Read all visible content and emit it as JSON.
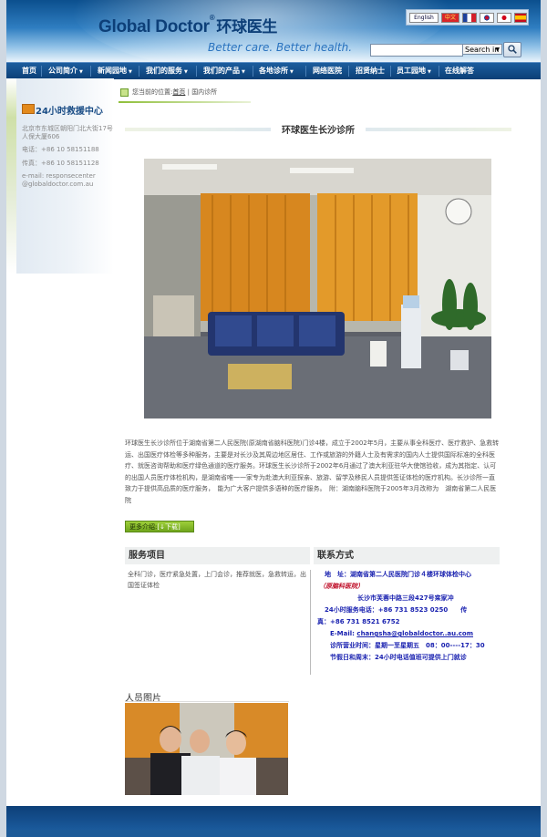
{
  "header": {
    "logo_en": "Global Doctor",
    "logo_reg": "®",
    "logo_cn": "环球医生",
    "slogan": "Better care. Better health.",
    "languages": [
      "English",
      "中文"
    ],
    "search": {
      "placeholder": "",
      "scope_option": "Search in"
    }
  },
  "nav": {
    "items": [
      {
        "label": "首页"
      },
      {
        "label": "公司简介"
      },
      {
        "label": "新闻园地"
      },
      {
        "label": "我们的服务"
      },
      {
        "label": "我们的产品"
      },
      {
        "label": "各地诊所"
      },
      {
        "label": "网络医院"
      },
      {
        "label": "招贤纳士"
      },
      {
        "label": "员工园地"
      },
      {
        "label": "在线解答"
      }
    ]
  },
  "sidebar": {
    "title": "24小时救援中心",
    "address": "北京市东城区朝阳门北大街17号人保大厦606",
    "phone": "电话：+86 10 58151188",
    "fax": "传真：+86 10 58151128",
    "email": "e-mail: responsecenter @globaldoctor.com.au"
  },
  "breadcrumb": {
    "prefix": "您当前的位置:",
    "home": "首页",
    "sep": "|",
    "current": "国内诊所"
  },
  "page": {
    "title": "环球医生长沙诊所",
    "description": "环球医生长沙诊所位于湖南省第二人民医院(原湖南省脑科医院)门诊4楼，成立于2002年5月，主要从事全科医疗、医疗救护、急救转运、出国医疗体检等多种服务，主要是对长沙及其周边地区居住、工作或旅游的外籍人士及有需求的国内人士提供国际标准的全科医疗、就医咨询帮助和医疗绿色通道的医疗服务。环球医生长沙诊所于2002年6月通过了澳大利亚驻华大使馆验收，成为其指定、认可的出国人员医疗体检机构，是湖南省唯一一家专为赴澳大利亚探亲、旅游、留学及移民人员提供签证体检的医疗机构。长沙诊所一直致力于提供高品质的医疗服务，　能为广大客户提供多语种的医疗服务。　附：湖南脑科医院于2005年3月改称为　湖南省第二人民医院",
    "more_label": "更多介绍:",
    "download_label": "[↓下载]"
  },
  "services": {
    "title": "服务项目",
    "text": "全科门诊，医疗紧急处置，上门会诊，推荐就医，急救转运，出国签证体检"
  },
  "contact": {
    "title": "联系方式",
    "address_line": "地　址：湖南省第二人民医院门诊４楼环球体检中心",
    "address_note": "（原脑科医院）",
    "street": "长沙市芙蓉中路三段427号寀家冲",
    "hotline": "24小时服务电话：+86 731 8523 0250　　传",
    "fax": "真：+86 731 8521 6752",
    "email_label": "E-Mail:",
    "email": "changsha@globaldoctor..au.com",
    "hours": "诊所营业时间：星期一至星期五　08：00----17：30",
    "holiday": "节假日和周末：24小时电话值班可提供上门就诊"
  },
  "staff": {
    "title": "人员图片"
  },
  "colors": {
    "brand_blue": "#0d3f78",
    "nav_blue": "#0b3f76",
    "accent_green": "#8fbf3a",
    "contact_blue": "#1a22b0",
    "contact_red": "#c0102a"
  }
}
